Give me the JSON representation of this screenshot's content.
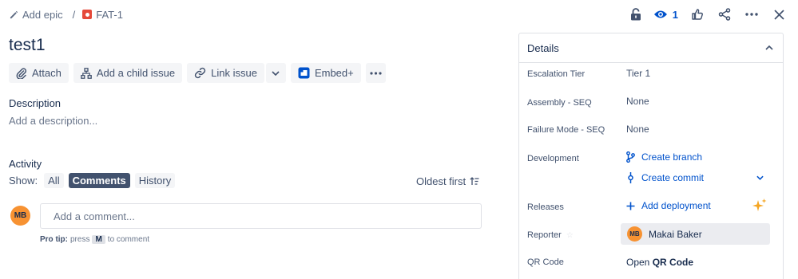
{
  "breadcrumb": {
    "add_epic": "Add epic",
    "separator": "/",
    "issue_key": "FAT-1"
  },
  "header_actions": {
    "watch_count": "1",
    "icons": [
      "lock-icon",
      "eye-icon",
      "thumbs-up-icon",
      "share-icon",
      "more-icon",
      "close-icon"
    ]
  },
  "issue": {
    "title": "test1"
  },
  "toolbar": {
    "attach": "Attach",
    "add_child": "Add a child issue",
    "link_issue": "Link issue",
    "embed": "Embed+"
  },
  "description": {
    "label": "Description",
    "placeholder": "Add a description..."
  },
  "activity": {
    "label": "Activity",
    "show_label": "Show:",
    "filters": [
      {
        "label": "All",
        "active": false
      },
      {
        "label": "Comments",
        "active": true
      },
      {
        "label": "History",
        "active": false
      }
    ],
    "sort": "Oldest first",
    "user_initials": "MB",
    "comment_placeholder": "Add a comment...",
    "protip_bold": "Pro tip:",
    "protip_press": "press",
    "protip_key": "M",
    "protip_rest": "to comment"
  },
  "details": {
    "header": "Details",
    "escalation_tier_label": "Escalation Tier",
    "escalation_tier_value": "Tier 1",
    "assembly_label": "Assembly - SEQ",
    "assembly_value": "None",
    "failure_mode_label": "Failure Mode - SEQ",
    "failure_mode_value": "None",
    "development_label": "Development",
    "create_branch": "Create branch",
    "create_commit": "Create commit",
    "releases_label": "Releases",
    "add_deployment": "Add deployment",
    "reporter_label": "Reporter",
    "reporter_initials": "MB",
    "reporter_name": "Makai Baker",
    "qr_label": "QR Code",
    "qr_open": "Open",
    "qr_code": "QR Code"
  },
  "colors": {
    "link": "#0052cc",
    "avatar": "#f79232",
    "issue_type": "#e5493a",
    "sparkle": "#f5a623"
  }
}
